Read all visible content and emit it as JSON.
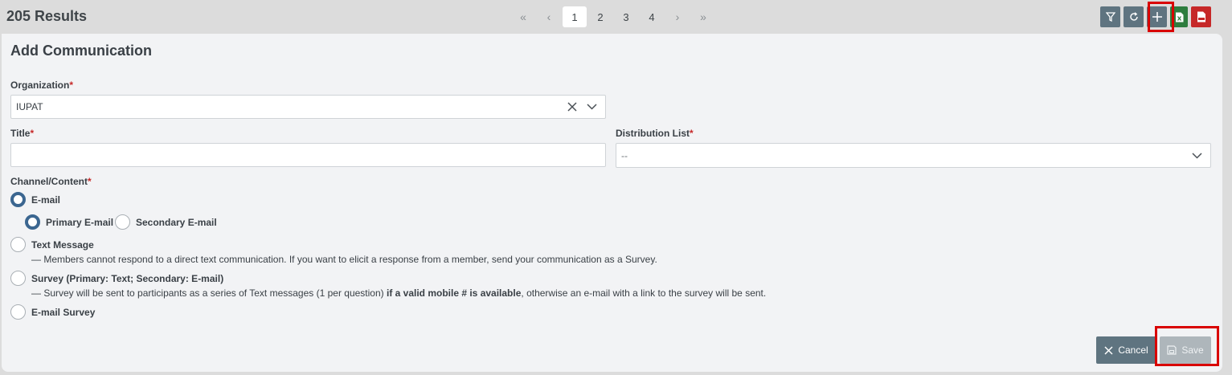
{
  "header": {
    "results": "205 Results",
    "pager": {
      "first": "«",
      "prev": "‹",
      "pages": [
        "1",
        "2",
        "3",
        "4"
      ],
      "active_page": "1",
      "next": "›",
      "last": "»"
    },
    "tools": [
      {
        "name": "filter-icon",
        "color": "#5f7480"
      },
      {
        "name": "refresh-icon",
        "color": "#5f7480"
      },
      {
        "name": "add-icon",
        "color": "#5f7480"
      },
      {
        "name": "excel-icon",
        "color": "#2e7d3e"
      },
      {
        "name": "pdf-icon",
        "color": "#c62828"
      }
    ]
  },
  "form": {
    "title": "Add Communication",
    "organization": {
      "label": "Organization",
      "required": "*",
      "value": "IUPAT"
    },
    "title_field": {
      "label": "Title",
      "required": "*",
      "value": ""
    },
    "distribution": {
      "label": "Distribution List",
      "required": "*",
      "value": "--"
    },
    "channel": {
      "label": "Channel/Content",
      "required": "*",
      "email": "E-mail",
      "primary_email": "Primary E-mail",
      "secondary_email": "Secondary E-mail",
      "text_message": "Text Message",
      "text_note": "— Members cannot respond to a direct text communication. If you want to elicit a response from a member, send your communication as a Survey.",
      "survey": "Survey (Primary: Text; Secondary: E-mail)",
      "survey_note_a": "— Survey will be sent to participants as a series of Text messages (1 per question) ",
      "survey_note_b": "if a valid mobile # is available",
      "survey_note_c": ", otherwise an e-mail with a link to the survey will be sent.",
      "email_survey": "E-mail Survey",
      "selected": "E-mail",
      "selected_sub": "Primary E-mail"
    },
    "buttons": {
      "cancel": "Cancel",
      "save": "Save"
    }
  },
  "colors": {
    "accent": "#3b6690",
    "slate": "#5f7480",
    "highlight": "#d90000"
  }
}
